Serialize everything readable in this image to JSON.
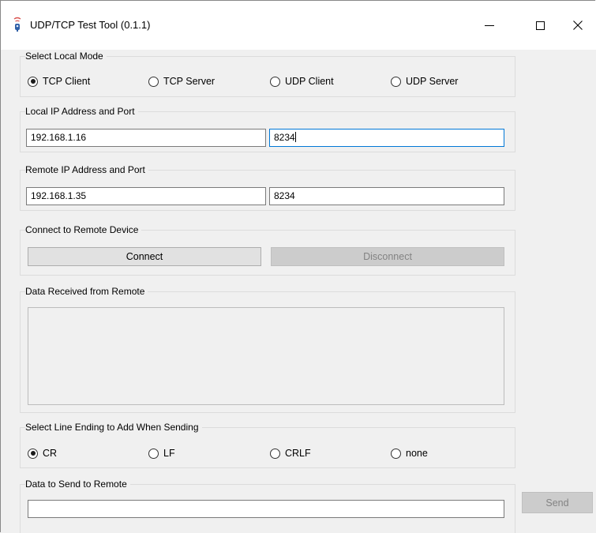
{
  "window": {
    "title": "UDP/TCP Test Tool (0.1.1)",
    "controls": {
      "minimize": "—",
      "maximize": "☐",
      "close": "✕"
    }
  },
  "local_mode": {
    "label": "Select Local Mode",
    "options": [
      "TCP Client",
      "TCP Server",
      "UDP Client",
      "UDP Server"
    ],
    "selected": "TCP Client"
  },
  "local_address": {
    "label": "Local IP Address and Port",
    "ip": "192.168.1.16",
    "port": "8234"
  },
  "remote_address": {
    "label": "Remote IP Address and Port",
    "ip": "192.168.1.35",
    "port": "8234"
  },
  "connection": {
    "label": "Connect to Remote Device",
    "connect_label": "Connect",
    "disconnect_label": "Disconnect"
  },
  "received": {
    "label": "Data Received from Remote",
    "content": ""
  },
  "line_ending": {
    "label": "Select Line Ending to Add When Sending",
    "options": [
      "CR",
      "LF",
      "CRLF",
      "none"
    ],
    "selected": "CR"
  },
  "send": {
    "label": "Data to Send to Remote",
    "value": "",
    "button_label": "Send"
  }
}
